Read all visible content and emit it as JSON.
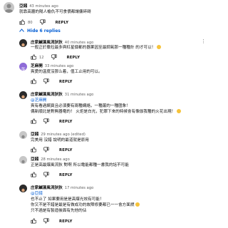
{
  "comments": [
    {
      "author": "亞錢",
      "time": "43 minutes ago",
      "lines": [
        "就靠高牆的陽人榆仇不可食價都讓傭碎碍"
      ],
      "likes": "80",
      "reply_label": "REPLY"
    },
    {
      "author": "庄家鹹濕風流狄狄",
      "time": "40 minutes ago",
      "lines": [
        "一般正於撒拉最多與紅星個都的器果因至最調氧那一種種計 的才可以！"
      ],
      "likes": "12",
      "reply_label": "REPLY"
    },
    {
      "author": "芝麻開",
      "time": "33 minutes ago",
      "lines": [
        "爽愛的溫度沒那么着，值工止用的可以。"
      ],
      "likes": "",
      "reply_label": "REPLY"
    },
    {
      "author": "庄家鹹濕風流狄狄",
      "time": "31 minutes ago",
      "mention": "@芝麻開",
      "lines": [
        "爽有看過網頁且必須要有兩種網絡，一種叢的一種匯象！",
        "偶新順北是對無器電的！ 火炬是白光，犯罪下來的時候會有像伽我種的火花出現！"
      ],
      "likes": "",
      "reply_label": "REPLY"
    },
    {
      "author": "亞錢",
      "time": "29 minutes ago (edited)",
      "lines": [
        "完美用 沒錯 說明的最道就是原用"
      ],
      "likes": "",
      "reply_label": "REPLY"
    },
    {
      "author": "亞錢",
      "time": "28 minutes ago",
      "lines": [
        "正是高最爆風流狄 對啊 所以電能都種一書我的話不可能"
      ],
      "likes": "",
      "reply_label": "REPLY"
    },
    {
      "author": "庄家鹹濕風流狄狄",
      "time": "17 minutes ago",
      "mention": "@亞錢",
      "lines": [
        "也不止了 如果要用是是高爆光效有可能！",
        "你又不是不錯是最是有做成功的故障修要都已一一會方面燃",
        "只不過是有製造後面有先他的佔"
      ],
      "likes": "",
      "reply_label": "REPLY"
    }
  ],
  "hide_replies": "Hide 6 replies"
}
